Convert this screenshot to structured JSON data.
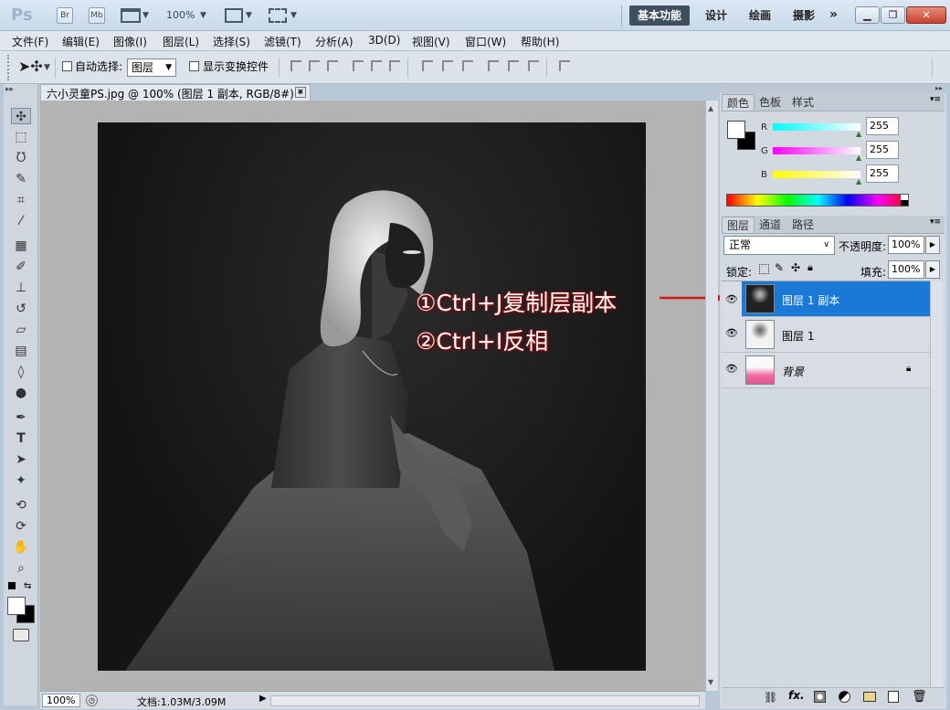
{
  "app": {
    "logo": "Ps",
    "bridge": "Br",
    "mini_bridge": "Mb",
    "zoom": "100%"
  },
  "workspaces": [
    "基本功能",
    "设计",
    "绘画",
    "摄影"
  ],
  "menu": [
    "文件(F)",
    "编辑(E)",
    "图像(I)",
    "图层(L)",
    "选择(S)",
    "滤镜(T)",
    "分析(A)",
    "3D(D)",
    "视图(V)",
    "窗口(W)",
    "帮助(H)"
  ],
  "options": {
    "auto_select_label": "自动选择:",
    "auto_select_value": "图层",
    "show_transform_label": "显示变换控件"
  },
  "document": {
    "tab_title": "六小灵童PS.jpg @ 100% (图层 1 副本, RGB/8#) *",
    "zoom": "100%",
    "doc_size": "文档:1.03M/3.09M"
  },
  "color_panel": {
    "tabs": [
      "颜色",
      "色板",
      "样式"
    ],
    "channels": [
      {
        "label": "R",
        "value": "255"
      },
      {
        "label": "G",
        "value": "255"
      },
      {
        "label": "B",
        "value": "255"
      }
    ]
  },
  "layers_panel": {
    "tabs": [
      "图层",
      "通道",
      "路径"
    ],
    "blend_mode": "正常",
    "opacity_label": "不透明度:",
    "opacity": "100%",
    "lock_label": "锁定:",
    "fill_label": "填充:",
    "fill": "100%",
    "layers": [
      {
        "name": "图层 1 副本",
        "selected": true
      },
      {
        "name": "图层 1",
        "selected": false
      },
      {
        "name": "背景",
        "selected": false,
        "locked": true
      }
    ]
  },
  "annotation": {
    "step1": "①Ctrl+J复制层副本",
    "step2": "②Ctrl+I反相"
  },
  "colors": {
    "selected_layer": "#1a78d6",
    "annotation_shadow": "#a01010"
  }
}
